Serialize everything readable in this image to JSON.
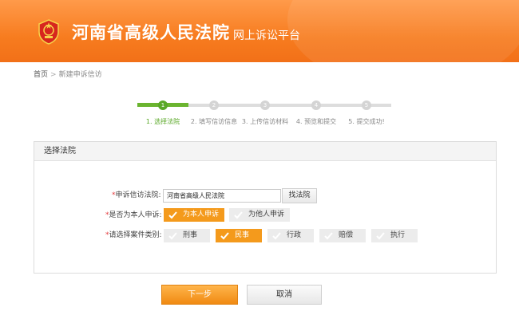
{
  "header": {
    "court_name": "河南省高级人民法院",
    "platform_name": "网上诉讼平台",
    "emblem_icon": "court-emblem-icon"
  },
  "breadcrumb": {
    "home": "首页",
    "current": "新建申诉信访"
  },
  "steps": [
    {
      "num": "1",
      "label": "1. 选择法院",
      "active": true
    },
    {
      "num": "2",
      "label": "2. 填写信访信息",
      "active": false
    },
    {
      "num": "3",
      "label": "3. 上传信访材料",
      "active": false
    },
    {
      "num": "4",
      "label": "4. 预览和提交",
      "active": false
    },
    {
      "num": "5",
      "label": "5. 提交成功!",
      "active": false
    }
  ],
  "panel": {
    "title": "选择法院"
  },
  "form": {
    "court_label": "申诉信访法院:",
    "court_value": "河南省高级人民法院",
    "find_button": "找法院",
    "self_label": "是否为本人申诉:",
    "self_options": [
      "为本人申诉",
      "为他人申诉"
    ],
    "type_label": "请选择案件类别:",
    "type_options": [
      "刑事",
      "民事",
      "行政",
      "赔偿",
      "执行"
    ],
    "required_mark": "*"
  },
  "actions": {
    "next": "下一步",
    "cancel": "取消"
  },
  "colors": {
    "header_orange": "#f77c1f",
    "step_active_green": "#5aa827",
    "selected_orange": "#f49a1c",
    "required_red": "#e4393c"
  }
}
